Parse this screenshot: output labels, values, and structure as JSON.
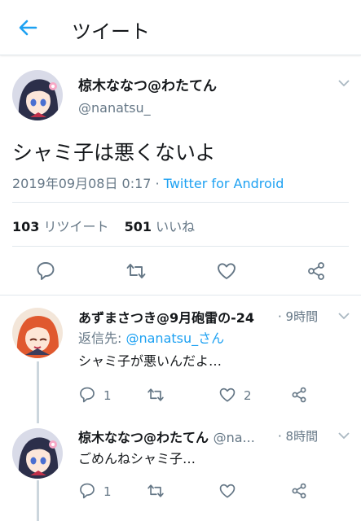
{
  "header": {
    "title": "ツイート"
  },
  "tweet": {
    "display_name": "椋木ななつ@わたてん",
    "handle": "@nanatsu_",
    "text": "シャミ子は悪くないよ",
    "timestamp": "2019年09月08日 0:17 · ",
    "client": "Twitter for Android",
    "retweet_count": "103",
    "retweet_label": "リツイート",
    "like_count": "501",
    "like_label": "いいね"
  },
  "replies": [
    {
      "display_name": "あずまさつき@9月砲雷の-24",
      "handle": "",
      "time": "· 9時間",
      "reply_prefix": "返信先: ",
      "reply_to": "@nanatsu_さん",
      "text": "シャミ子が悪いんだよ…",
      "reply_count": "1",
      "like_count": "2"
    },
    {
      "display_name": "椋木ななつ@わたてん",
      "handle": "@na...",
      "time": "· 8時間",
      "text": "ごめんねシャミ子…",
      "reply_count": "1"
    }
  ],
  "icons": {
    "back": "arrow-left-icon",
    "reply": "reply-icon",
    "retweet": "retweet-icon",
    "like": "heart-icon",
    "share": "share-icon",
    "caret": "chevron-down-icon"
  },
  "colors": {
    "accent": "#1da1f2",
    "text": "#14171a",
    "muted": "#657786",
    "divider": "#e1e8ed"
  }
}
